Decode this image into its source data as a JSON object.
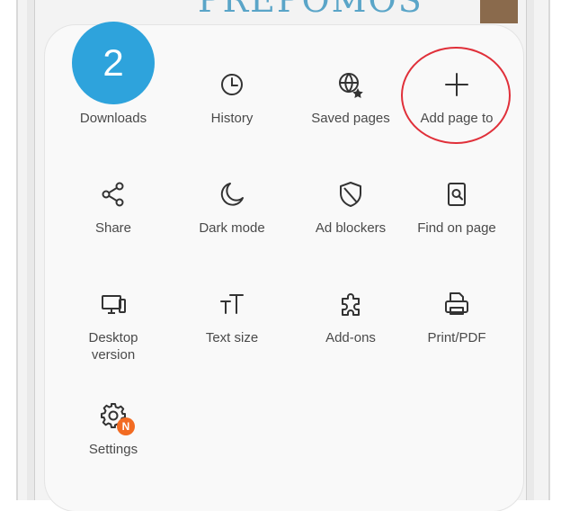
{
  "header": {
    "step_number": "2",
    "background_title": "PREPOMOS"
  },
  "menu": {
    "items": [
      {
        "label": "Downloads",
        "icon": "download-icon"
      },
      {
        "label": "History",
        "icon": "clock-icon"
      },
      {
        "label": "Saved pages",
        "icon": "globe-star-icon"
      },
      {
        "label": "Add page to",
        "icon": "plus-icon"
      },
      {
        "label": "Share",
        "icon": "share-icon"
      },
      {
        "label": "Dark mode",
        "icon": "moon-icon"
      },
      {
        "label": "Ad blockers",
        "icon": "shield-icon"
      },
      {
        "label": "Find on page",
        "icon": "find-in-page-icon"
      },
      {
        "label": "Desktop\nversion",
        "icon": "monitor-icon"
      },
      {
        "label": "Text size",
        "icon": "text-size-icon"
      },
      {
        "label": "Add-ons",
        "icon": "puzzle-icon"
      },
      {
        "label": "Print/PDF",
        "icon": "printer-icon"
      },
      {
        "label": "Settings",
        "icon": "gear-icon"
      }
    ],
    "settings_badge": "N"
  },
  "colors": {
    "badge_blue": "#2ea3dc",
    "highlight_red": "#e0303a",
    "notification_orange": "#f26b22"
  }
}
